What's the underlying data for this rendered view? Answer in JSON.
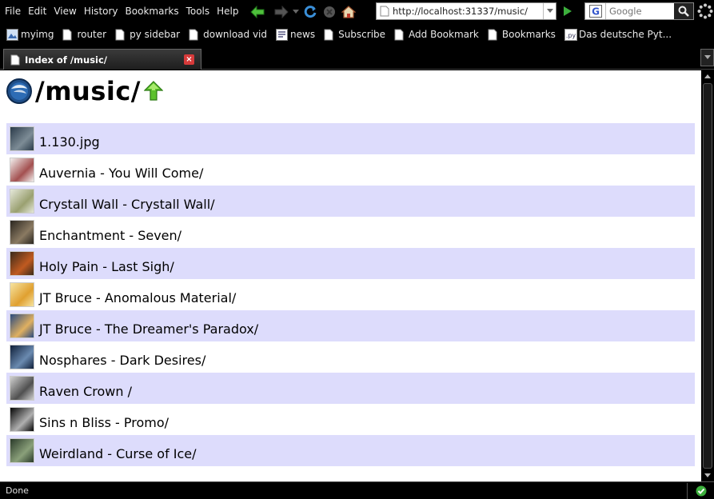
{
  "menu": [
    {
      "id": "file",
      "label": "File"
    },
    {
      "id": "edit",
      "label": "Edit"
    },
    {
      "id": "view",
      "label": "View"
    },
    {
      "id": "history",
      "label": "History"
    },
    {
      "id": "bookmarks",
      "label": "Bookmarks"
    },
    {
      "id": "tools",
      "label": "Tools"
    },
    {
      "id": "help",
      "label": "Help"
    }
  ],
  "nav": {
    "url": "http://localhost:31337/music/",
    "search_placeholder": "Google"
  },
  "bookmarks": [
    {
      "id": "myimg",
      "label": "myimg",
      "icon": "image-icon"
    },
    {
      "id": "router",
      "label": "router",
      "icon": "page-icon"
    },
    {
      "id": "py-sidebar",
      "label": "py sidebar",
      "icon": "page-icon"
    },
    {
      "id": "download-vid",
      "label": "download vid",
      "icon": "page-icon"
    },
    {
      "id": "news",
      "label": "news",
      "icon": "news-icon"
    },
    {
      "id": "subscribe",
      "label": "Subscribe",
      "icon": "page-icon"
    },
    {
      "id": "add-bookmark",
      "label": "Add Bookmark",
      "icon": "page-icon"
    },
    {
      "id": "bookmarks-link",
      "label": "Bookmarks",
      "icon": "page-icon"
    },
    {
      "id": "das-deutsche",
      "label": "Das deutsche Pyt...",
      "icon": "py-icon"
    }
  ],
  "tab": {
    "title": "Index of /music/",
    "close": "×"
  },
  "page": {
    "title": "/music/"
  },
  "entries": [
    {
      "label": "1.130.jpg",
      "thumb": [
        "#2b3b4a",
        "#7d8c96"
      ]
    },
    {
      "label": "Auvernia - You Will Come/",
      "thumb": [
        "#f2f0ee",
        "#a35050"
      ]
    },
    {
      "label": "Crystall Wall - Crystall Wall/",
      "thumb": [
        "#e5e8da",
        "#9aa070"
      ]
    },
    {
      "label": "Enchantment - Seven/",
      "thumb": [
        "#2a2620",
        "#8a7a62"
      ]
    },
    {
      "label": "Holy Pain - Last Sigh/",
      "thumb": [
        "#3a2a1a",
        "#c05a20"
      ]
    },
    {
      "label": "JT Bruce - Anomalous Material/",
      "thumb": [
        "#f6e4a0",
        "#e0a030"
      ]
    },
    {
      "label": "JT Bruce - The Dreamer's Paradox/",
      "thumb": [
        "#2a4a80",
        "#e0b060"
      ]
    },
    {
      "label": "Nosphares - Dark Desires/",
      "thumb": [
        "#10203a",
        "#6a8ab0"
      ]
    },
    {
      "label": "Raven Crown /",
      "thumb": [
        "#d0d0d0",
        "#505050"
      ]
    },
    {
      "label": "Sins n Bliss - Promo/",
      "thumb": [
        "#050505",
        "#b0b0b0"
      ]
    },
    {
      "label": "Weirdland - Curse of Ice/",
      "thumb": [
        "#2a3a2a",
        "#8aa07a"
      ]
    }
  ],
  "status": {
    "text": "Done"
  },
  "colors": {
    "row_alt": "#dddcfc",
    "accent_green": "#3caf3c"
  }
}
